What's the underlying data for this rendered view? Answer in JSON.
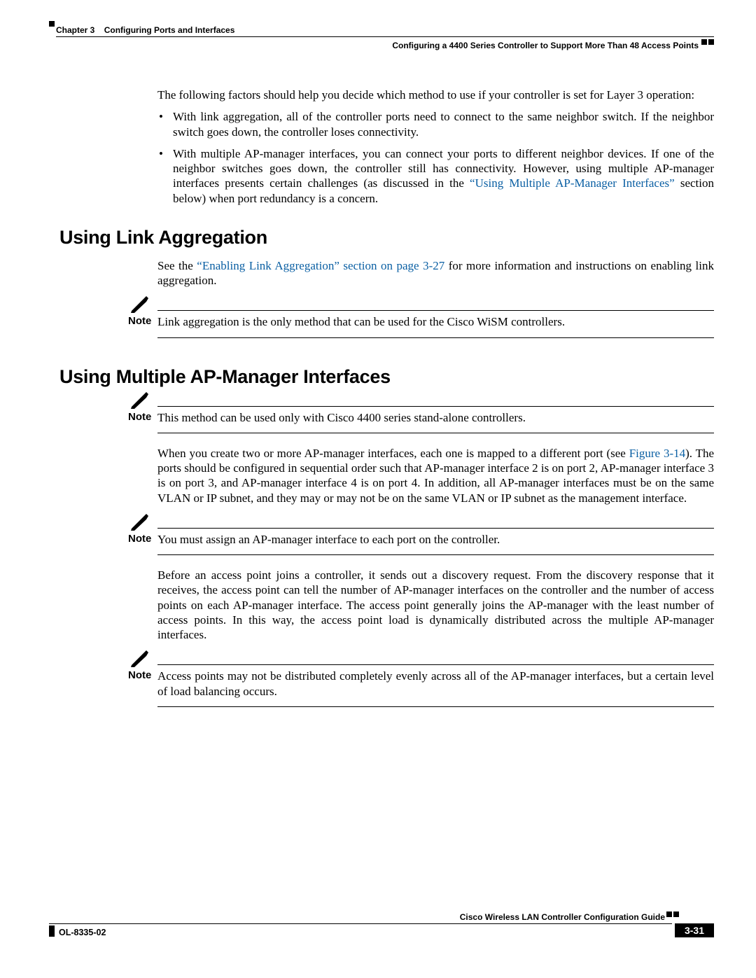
{
  "header": {
    "chapter_label": "Chapter 3",
    "chapter_title": "Configuring Ports and Interfaces",
    "section_title": "Configuring a 4400 Series Controller to Support More Than 48 Access Points"
  },
  "body": {
    "intro": "The following factors should help you decide which method to use if your controller is set for Layer 3 operation:",
    "bullets": [
      {
        "text": "With link aggregation, all of the controller ports need to connect to the same neighbor switch. If the neighbor switch goes down, the controller loses connectivity."
      },
      {
        "pre": "With multiple AP-manager interfaces, you can connect your ports to different neighbor devices. If one of the neighbor switches goes down, the controller still has connectivity. However, using multiple AP-manager interfaces presents certain challenges (as discussed in the ",
        "link": "“Using Multiple AP-Manager Interfaces”",
        "post": " section below) when port redundancy is a concern."
      }
    ],
    "h1": "Using Link Aggregation",
    "la_p1_pre": "See the ",
    "la_p1_link": "“Enabling Link Aggregation” section on page 3-27",
    "la_p1_post": " for more information and instructions on enabling link aggregation.",
    "note1_label": "Note",
    "note1_text": "Link aggregation is the only method that can be used for the Cisco WiSM controllers.",
    "h2": "Using Multiple AP-Manager Interfaces",
    "note2_label": "Note",
    "note2_text": "This method can be used only with Cisco 4400 series stand-alone controllers.",
    "apm_p1_pre": "When you create two or more AP-manager interfaces, each one is mapped to a different port (see ",
    "apm_p1_link": "Figure 3-14",
    "apm_p1_post": "). The ports should be configured in sequential order such that AP-manager interface 2 is on port 2, AP-manager interface 3 is on port 3, and AP-manager interface 4 is on port 4. In addition, all AP-manager interfaces must be on the same VLAN or IP subnet, and they may or may not be on the same VLAN or IP subnet as the management interface.",
    "note3_label": "Note",
    "note3_text": "You must assign an AP-manager interface to each port on the controller.",
    "apm_p2": "Before an access point joins a controller, it sends out a discovery request. From the discovery response that it receives, the access point can tell the number of AP-manager interfaces on the controller and the number of access points on each AP-manager interface. The access point generally joins the AP-manager with the least number of access points. In this way, the access point load is dynamically distributed across the multiple AP-manager interfaces.",
    "note4_label": "Note",
    "note4_text": "Access points may not be distributed completely evenly across all of the AP-manager interfaces, but a certain level of load balancing occurs."
  },
  "footer": {
    "guide_title": "Cisco Wireless LAN Controller Configuration Guide",
    "doc_number": "OL-8335-02",
    "page_number": "3-31"
  }
}
